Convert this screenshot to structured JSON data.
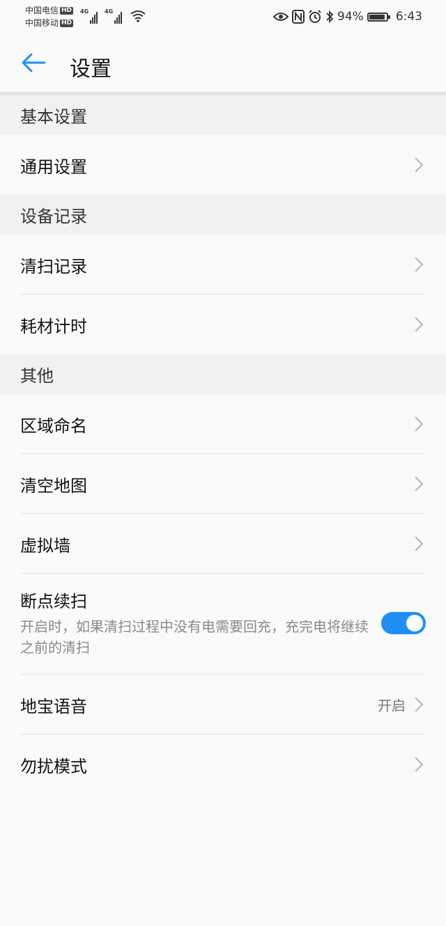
{
  "status_bar": {
    "carrier1": "中国电信",
    "carrier2": "中国移动",
    "hd": "HD",
    "net1": "4G",
    "net2": "4G",
    "battery_pct": "94%",
    "time": "6:43"
  },
  "header": {
    "title": "设置",
    "accent_color": "#1f8ff7"
  },
  "sections": {
    "basic": {
      "header": "基本设置",
      "general": "通用设置"
    },
    "device": {
      "header": "设备记录",
      "clean_record": "清扫记录",
      "consumables": "耗材计时"
    },
    "other": {
      "header": "其他",
      "zone_naming": "区域命名",
      "clear_map": "清空地图",
      "virtual_wall": "虚拟墙",
      "resume": {
        "label": "断点续扫",
        "desc": "开启时，如果清扫过程中没有电需要回充，充完电将继续之前的清扫",
        "enabled": true
      },
      "voice": {
        "label": "地宝语音",
        "value": "开启"
      },
      "dnd": "勿扰模式"
    }
  }
}
